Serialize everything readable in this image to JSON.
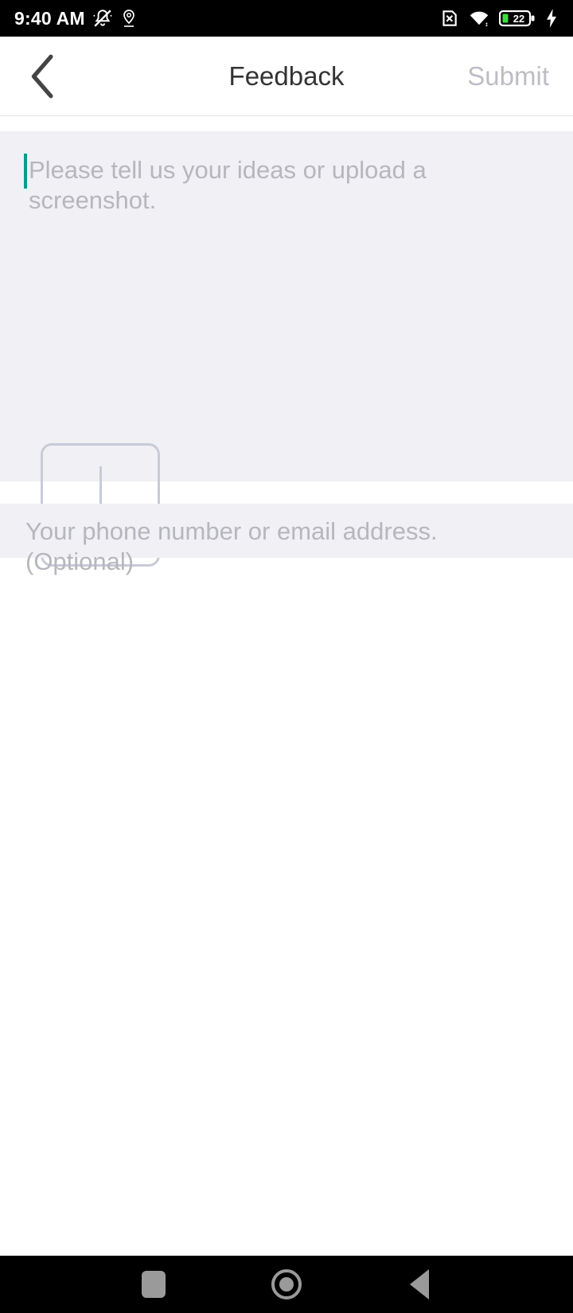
{
  "status_bar": {
    "time": "9:40 AM",
    "battery_level": "22",
    "icons": {
      "silent": "bell-slash-icon",
      "location": "location-pin-icon",
      "sim": "no-sim-card-icon",
      "wifi": "wifi-icon",
      "battery": "battery-icon",
      "charging": "charging-bolt-icon"
    },
    "colors": {
      "background": "#000000",
      "text": "#ffffff",
      "battery_fill": "#3ddc3d"
    }
  },
  "header": {
    "back_icon": "chevron-left-icon",
    "title": "Feedback",
    "submit_label": "Submit",
    "submit_disabled_color": "#bdbdc3",
    "title_color": "#333333"
  },
  "feedback_panel": {
    "textarea_placeholder": "Please tell us your ideas or upload a screenshot.",
    "textarea_value": "",
    "caret_color": "#0c9b8a",
    "panel_background": "#f0f0f5",
    "upload_button": {
      "icon": "plus-icon",
      "border_color": "#c8cad8"
    }
  },
  "contact_panel": {
    "placeholder": "Your phone number or email address. (Optional)",
    "value": "",
    "panel_background": "#f0f0f5"
  },
  "nav_bar": {
    "recents_icon": "square-icon",
    "home_icon": "circle-icon",
    "back_icon": "triangle-left-icon",
    "icon_color": "#9a9a9a",
    "background": "#000000"
  }
}
